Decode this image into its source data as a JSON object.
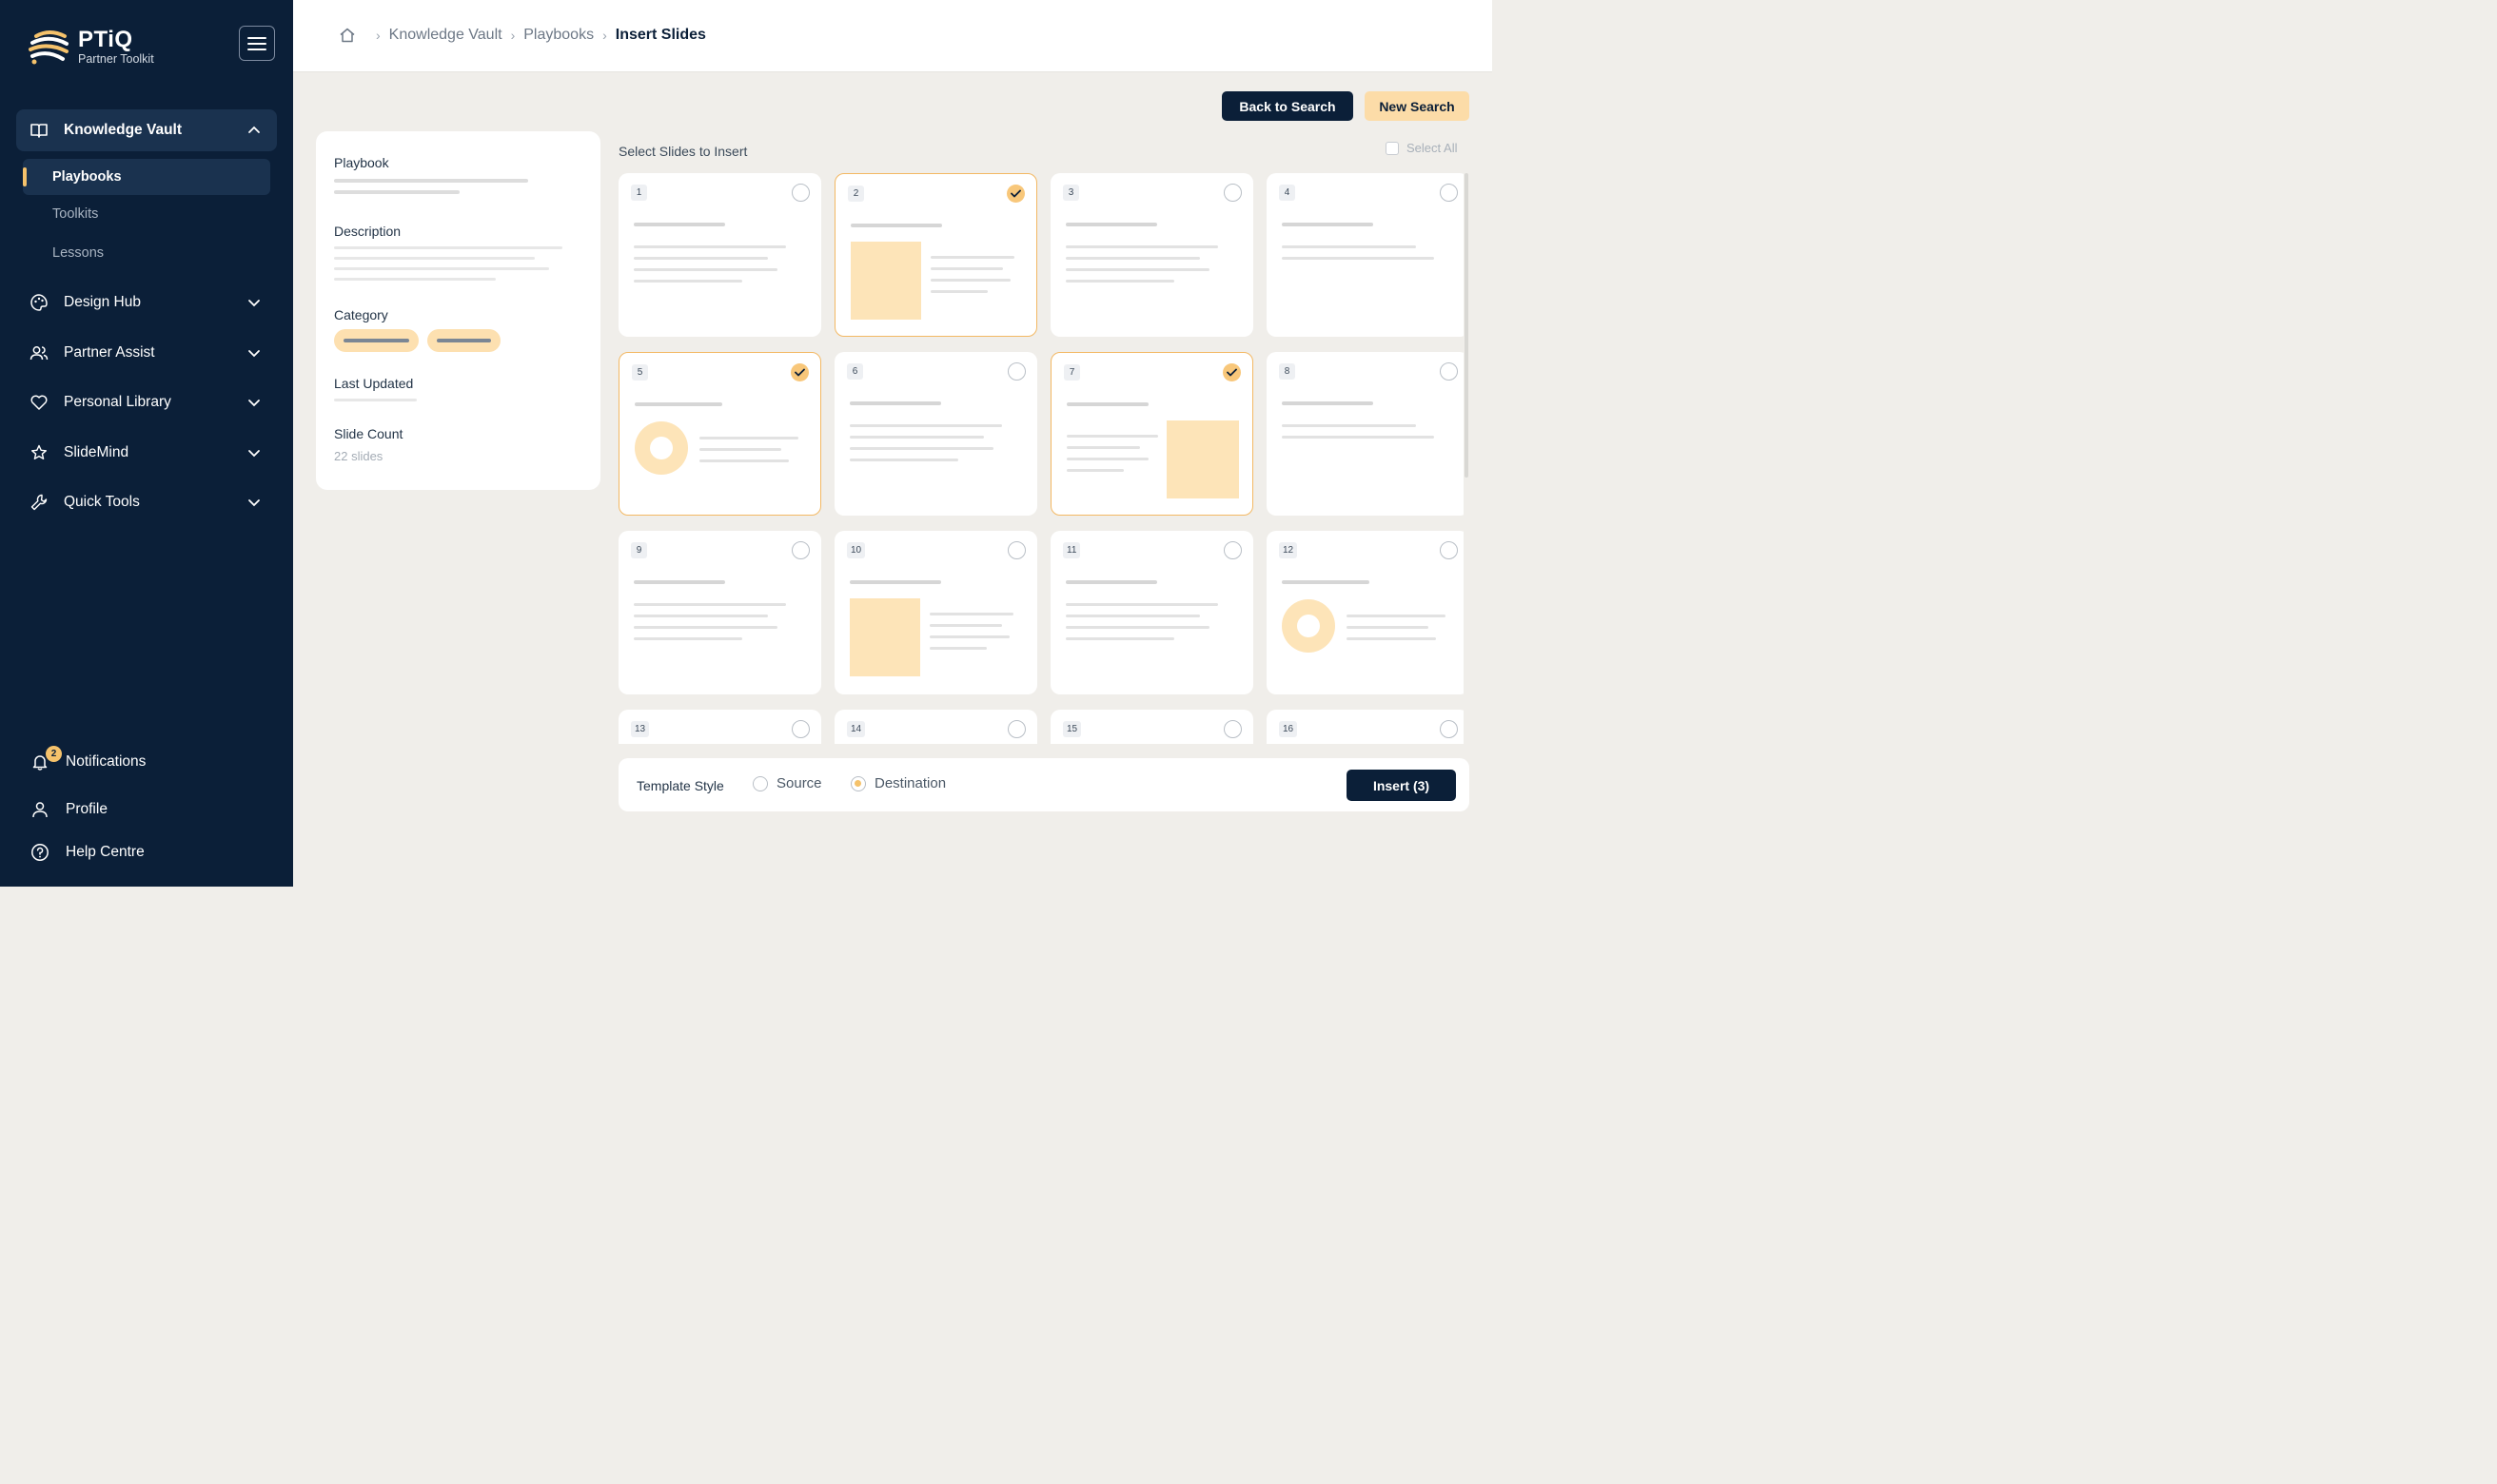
{
  "brand": {
    "title": "PTiQ",
    "subtitle": "Partner Toolkit",
    "logo_icon": "spiral-logo-icon",
    "accent": "#f5c26b",
    "sidebar_bg": "#0b1f38"
  },
  "sidebar": {
    "groups": [
      {
        "label": "Knowledge Vault",
        "icon": "book-open-icon",
        "expanded": true,
        "items": [
          {
            "label": "Playbooks",
            "active": true
          },
          {
            "label": "Toolkits"
          },
          {
            "label": "Lessons"
          }
        ]
      },
      {
        "label": "Design Hub",
        "icon": "palette-icon"
      },
      {
        "label": "Partner Assist",
        "icon": "users-icon"
      },
      {
        "label": "Personal Library",
        "icon": "heart-icon"
      },
      {
        "label": "SlideMind",
        "icon": "star-icon"
      },
      {
        "label": "Quick Tools",
        "icon": "wrench-icon"
      }
    ],
    "bottom": [
      {
        "label": "Notifications",
        "icon": "bell-icon",
        "badge": "2"
      },
      {
        "label": "Profile",
        "icon": "user-icon"
      },
      {
        "label": "Help Centre",
        "icon": "help-circle-icon"
      }
    ]
  },
  "breadcrumb": {
    "items": [
      "Knowledge Vault",
      "Playbooks"
    ],
    "current": "Insert Slides"
  },
  "actions": {
    "back": "Back to Search",
    "new": "New Search"
  },
  "details": {
    "playbook": "Playbook",
    "description": "Description",
    "category": "Category",
    "last_updated": "Last Updated",
    "slide_count": "Slide Count",
    "slide_count_value": "22 slides"
  },
  "slides": {
    "title": "Select Slides to Insert",
    "select_all": "Select All",
    "items": [
      {
        "n": "1",
        "selected": false,
        "layout": "text"
      },
      {
        "n": "2",
        "selected": true,
        "layout": "image-left"
      },
      {
        "n": "3",
        "selected": false,
        "layout": "text"
      },
      {
        "n": "4",
        "selected": false,
        "layout": "text-short"
      },
      {
        "n": "5",
        "selected": true,
        "layout": "donut"
      },
      {
        "n": "6",
        "selected": false,
        "layout": "text"
      },
      {
        "n": "7",
        "selected": true,
        "layout": "image-right"
      },
      {
        "n": "8",
        "selected": false,
        "layout": "text-short"
      },
      {
        "n": "9",
        "selected": false,
        "layout": "text"
      },
      {
        "n": "10",
        "selected": false,
        "layout": "image-left"
      },
      {
        "n": "11",
        "selected": false,
        "layout": "text"
      },
      {
        "n": "12",
        "selected": false,
        "layout": "donut"
      },
      {
        "n": "13",
        "selected": false,
        "layout": "text"
      },
      {
        "n": "14",
        "selected": false,
        "layout": "text"
      },
      {
        "n": "15",
        "selected": false,
        "layout": "text"
      },
      {
        "n": "16",
        "selected": false,
        "layout": "text"
      }
    ]
  },
  "template": {
    "label": "Template Style",
    "options": [
      "Source",
      "Destination"
    ],
    "selected": "Destination"
  },
  "insert_button": "Insert (3)"
}
